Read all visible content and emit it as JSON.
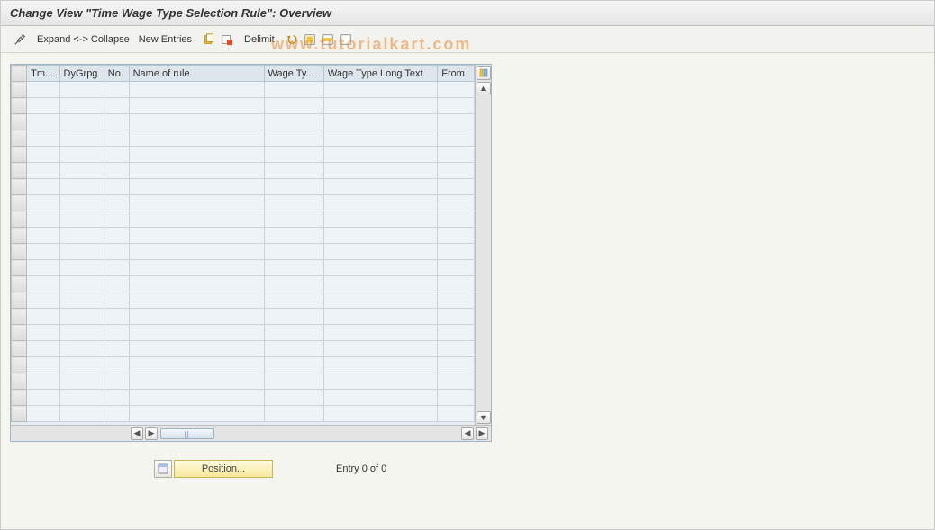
{
  "title": "Change View \"Time Wage Type Selection Rule\": Overview",
  "toolbar": {
    "expand_collapse": "Expand <-> Collapse",
    "new_entries": "New Entries",
    "delimit": "Delimit"
  },
  "watermark": "www.tutorialkart.com",
  "columns": {
    "tm": "Tm....",
    "dygrpg": "DyGrpg",
    "no": "No.",
    "name": "Name of rule",
    "wageTy": "Wage Ty...",
    "wageLong": "Wage Type Long Text",
    "from": "From"
  },
  "rows": 21,
  "footer": {
    "position_label": "Position...",
    "entry_status": "Entry 0 of 0"
  }
}
